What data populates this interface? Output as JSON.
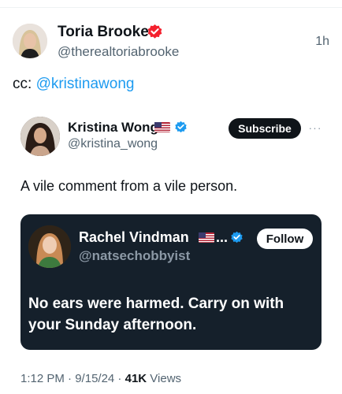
{
  "post": {
    "author_name": "Toria Brooke",
    "author_handle": "@therealtoriabrooke",
    "time_ago": "1h",
    "cc_label": "cc: ",
    "mention": "@kristinawong"
  },
  "quoted": {
    "author_name": "Kristina Wong",
    "author_handle": "@kristina_wong",
    "subscribe_label": "Subscribe",
    "more_label": "···",
    "text": "A vile comment from a vile person."
  },
  "inner_quote": {
    "author_name": "Rachel Vindman",
    "name_ellipsis": "...",
    "author_handle": "@natsechobbyist",
    "follow_label": "Follow",
    "text": "No ears were harmed. Carry on with your Sunday afternoon."
  },
  "meta": {
    "time": "1:12 PM",
    "sep1": " · ",
    "date": "9/15/24",
    "sep2": " · ",
    "views_count": "41K",
    "views_label": " Views"
  },
  "icons": {
    "affiliate_badge": "red-affiliate-badge-icon",
    "verified_badge": "blue-verified-badge-icon",
    "flag": "us-flag-icon",
    "more": "more-icon"
  },
  "colors": {
    "mention": "#1d9bf0",
    "verified": "#1d9bf0",
    "affiliate": "#f4212e",
    "card_bg": "#15202b"
  }
}
